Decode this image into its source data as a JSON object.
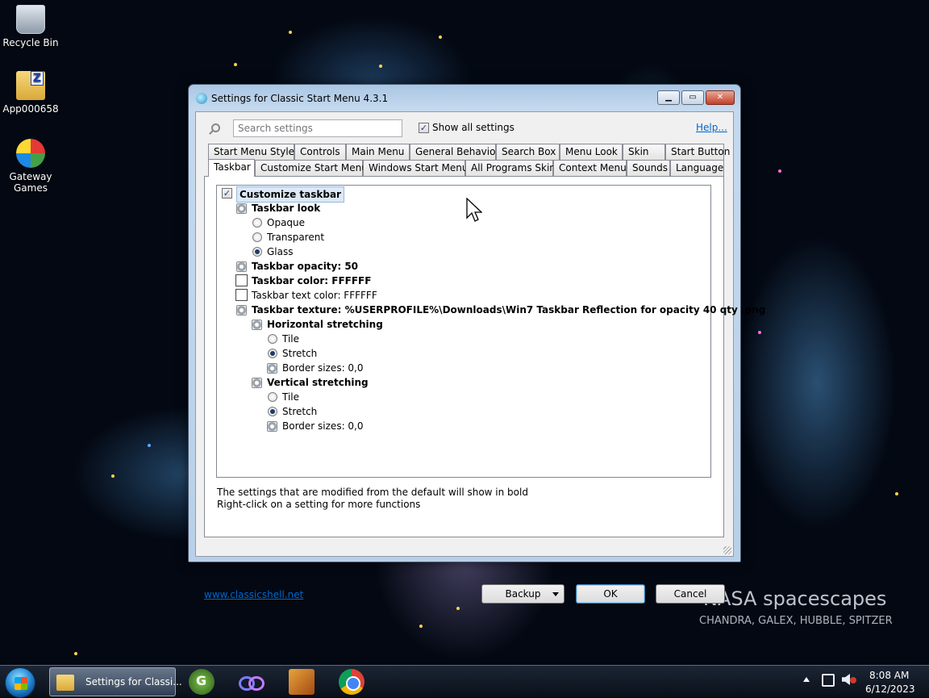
{
  "desktop": {
    "icons": [
      {
        "label": "Recycle Bin"
      },
      {
        "label": "App000658"
      },
      {
        "label": "Gateway Games"
      }
    ],
    "wallpaper_title": "NASA spacescapes",
    "wallpaper_subtitle": "CHANDRA, GALEX, HUBBLE, SPITZER"
  },
  "window": {
    "title": "Settings for Classic Start Menu 4.3.1",
    "search_placeholder": "Search settings",
    "show_all_label": "Show all settings",
    "show_all_checked": true,
    "help_label": "Help...",
    "tabs_row1": [
      "Start Menu Style",
      "Controls",
      "Main Menu",
      "General Behavior",
      "Search Box",
      "Menu Look",
      "Skin",
      "Start Button"
    ],
    "tabs_row2": [
      "Taskbar",
      "Customize Start Menu",
      "Windows Start Menu",
      "All Programs Skin",
      "Context Menu",
      "Sounds",
      "Language"
    ],
    "active_tab": "Taskbar",
    "tree": {
      "root": "Customize taskbar",
      "look_group": "Taskbar look",
      "look_opaque": "Opaque",
      "look_transparent": "Transparent",
      "look_glass": "Glass",
      "opacity": "Taskbar opacity: 50",
      "color": "Taskbar color: FFFFFF",
      "text_color": "Taskbar text color: FFFFFF",
      "texture": "Taskbar texture: %USERPROFILE%\\Downloads\\Win7 Taskbar Reflection for opacity 40 qty .png",
      "h_stretch": "Horizontal stretching",
      "h_tile": "Tile",
      "h_stretch_opt": "Stretch",
      "h_border": "Border sizes: 0,0",
      "v_stretch": "Vertical stretching",
      "v_tile": "Tile",
      "v_stretch_opt": "Stretch",
      "v_border": "Border sizes: 0,0"
    },
    "info_line1": "The settings that are modified from the default will show in bold",
    "info_line2": "Right-click on a setting for more functions",
    "website_link": "www.classicshell.net",
    "backup_label": "Backup",
    "ok_label": "OK",
    "cancel_label": "Cancel"
  },
  "taskbar": {
    "active_task_label": "Settings for Classi...",
    "clock_time": "8:08 AM",
    "clock_date": "6/12/2023"
  }
}
